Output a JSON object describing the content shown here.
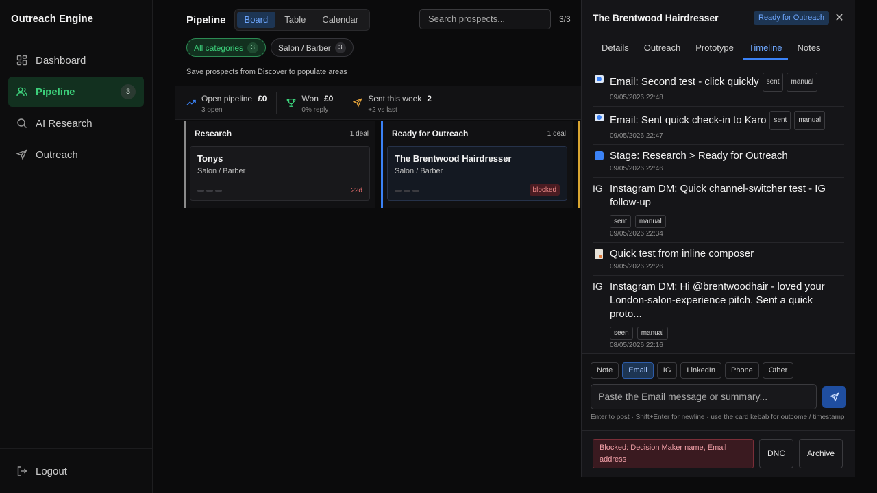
{
  "app": {
    "title": "Outreach Engine"
  },
  "sidebar": {
    "items": [
      {
        "label": "Dashboard"
      },
      {
        "label": "Pipeline",
        "badge": "3"
      },
      {
        "label": "AI Research"
      },
      {
        "label": "Outreach"
      }
    ],
    "logout": "Logout"
  },
  "header": {
    "title": "Pipeline",
    "views": [
      "Board",
      "Table",
      "Calendar"
    ],
    "active_view": "Board",
    "search_placeholder": "Search prospects...",
    "count": "3/3"
  },
  "filters": {
    "chips": [
      {
        "label": "All categories",
        "count": "3",
        "active": true
      },
      {
        "label": "Salon / Barber",
        "count": "3",
        "active": false
      }
    ],
    "hint": "Save prospects from Discover to populate areas"
  },
  "stats": [
    {
      "label": "Open pipeline",
      "value": "£0",
      "sub": "3 open",
      "icon": "trending-up-icon"
    },
    {
      "label": "Won",
      "value": "£0",
      "sub": "0% reply",
      "icon": "trophy-icon"
    },
    {
      "label": "Sent this week",
      "value": "2",
      "sub": "+2 vs last",
      "icon": "send-icon"
    }
  ],
  "board": {
    "columns": [
      {
        "title": "Research",
        "count": "1 deal",
        "card": {
          "title": "Tonys",
          "sub": "Salon / Barber",
          "age": "22d"
        }
      },
      {
        "title": "Ready for Outreach",
        "count": "1 deal",
        "card": {
          "title": "The Brentwood Hairdresser",
          "sub": "Salon / Barber",
          "flag": "blocked"
        }
      }
    ]
  },
  "drawer": {
    "title": "The Brentwood Hairdresser",
    "stage": "Ready for Outreach",
    "tabs": [
      "Details",
      "Outreach",
      "Prototype",
      "Timeline",
      "Notes"
    ],
    "active_tab": "Timeline",
    "timeline": [
      {
        "icon": "email",
        "text": "Email: Second test - click quickly",
        "tags": [
          "sent",
          "manual"
        ],
        "time": "09/05/2026 22:48"
      },
      {
        "icon": "email",
        "text": "Email: Sent quick check-in to Karo",
        "tags": [
          "sent",
          "manual"
        ],
        "time": "09/05/2026 22:47"
      },
      {
        "icon": "stage",
        "text": "Stage: Research > Ready for Outreach",
        "tags": [],
        "time": "09/05/2026 22:46"
      },
      {
        "icon": "IG",
        "text": "Instagram DM: Quick channel-switcher test - IG follow-up",
        "tags": [
          "sent",
          "manual"
        ],
        "time": "09/05/2026 22:34"
      },
      {
        "icon": "note",
        "text": "Quick test from inline composer",
        "tags": [],
        "time": "09/05/2026 22:26"
      },
      {
        "icon": "IG",
        "text": "Instagram DM: Hi @brentwoodhair - loved your London-salon-experience pitch. Sent a quick proto...",
        "tags": [
          "seen",
          "manual"
        ],
        "time": "08/05/2026 22:16"
      }
    ],
    "composer": {
      "channels": [
        "Note",
        "Email",
        "IG",
        "LinkedIn",
        "Phone",
        "Other"
      ],
      "active_channel": "Email",
      "placeholder": "Paste the Email message or summary...",
      "hint": "Enter to post · Shift+Enter for newline · use the card kebab for outcome / timestamp"
    },
    "footer": {
      "blocked": "Blocked: Decision Maker name, Email address",
      "dnc": "DNC",
      "archive": "Archive"
    }
  }
}
